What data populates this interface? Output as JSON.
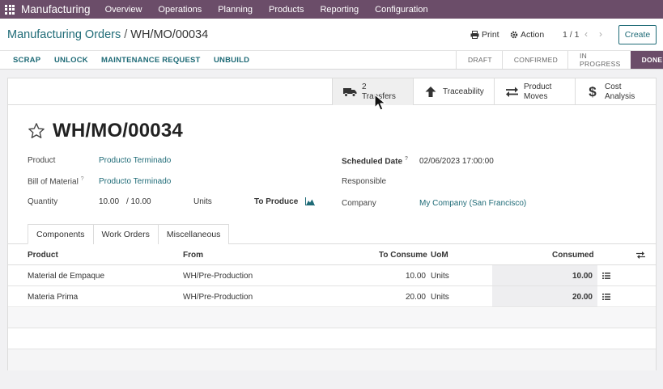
{
  "nav": {
    "app_name": "Manufacturing",
    "items": [
      "Overview",
      "Operations",
      "Planning",
      "Products",
      "Reporting",
      "Configuration"
    ]
  },
  "control": {
    "breadcrumb_parent": "Manufacturing Orders",
    "breadcrumb_separator": "/",
    "breadcrumb_current": "WH/MO/00034",
    "print_label": "Print",
    "action_label": "Action",
    "pager": "1 / 1",
    "create_label": "Create"
  },
  "statusbar": {
    "buttons": [
      "SCRAP",
      "UNLOCK",
      "MAINTENANCE REQUEST",
      "UNBUILD"
    ],
    "stages": [
      "DRAFT",
      "CONFIRMED",
      "IN PROGRESS",
      "DONE"
    ],
    "current_stage": "DONE"
  },
  "smart_buttons": {
    "transfers": {
      "count": "2",
      "label": "Transfers"
    },
    "traceability": {
      "label": "Traceability"
    },
    "product_moves": {
      "line1": "Product",
      "line2": "Moves"
    },
    "cost_analysis": {
      "line1": "Cost",
      "line2": "Analysis"
    }
  },
  "record": {
    "title": "WH/MO/00034",
    "fields": {
      "product_label": "Product",
      "product_value": "Producto Terminado",
      "bom_label": "Bill of Material",
      "bom_value": "Producto Terminado",
      "quantity_label": "Quantity",
      "quantity_value": "10.00",
      "quantity_total": "/ 10.00",
      "quantity_uom": "Units",
      "to_produce_label": "To Produce",
      "scheduled_label": "Scheduled Date",
      "scheduled_value": "02/06/2023 17:00:00",
      "responsible_label": "Responsible",
      "company_label": "Company",
      "company_value": "My Company (San Francisco)",
      "help_mark": "?"
    }
  },
  "tabs": [
    "Components",
    "Work Orders",
    "Miscellaneous"
  ],
  "components": {
    "headers": {
      "product": "Product",
      "from": "From",
      "to_consume": "To Consume",
      "uom": "UoM",
      "consumed": "Consumed"
    },
    "rows": [
      {
        "product": "Material de Empaque",
        "from": "WH/Pre-Production",
        "to_consume": "10.00",
        "uom": "Units",
        "consumed": "10.00"
      },
      {
        "product": "Materia Prima",
        "from": "WH/Pre-Production",
        "to_consume": "20.00",
        "uom": "Units",
        "consumed": "20.00"
      }
    ]
  },
  "colors": {
    "brand": "#6b4d69",
    "link": "#1f6b77"
  }
}
